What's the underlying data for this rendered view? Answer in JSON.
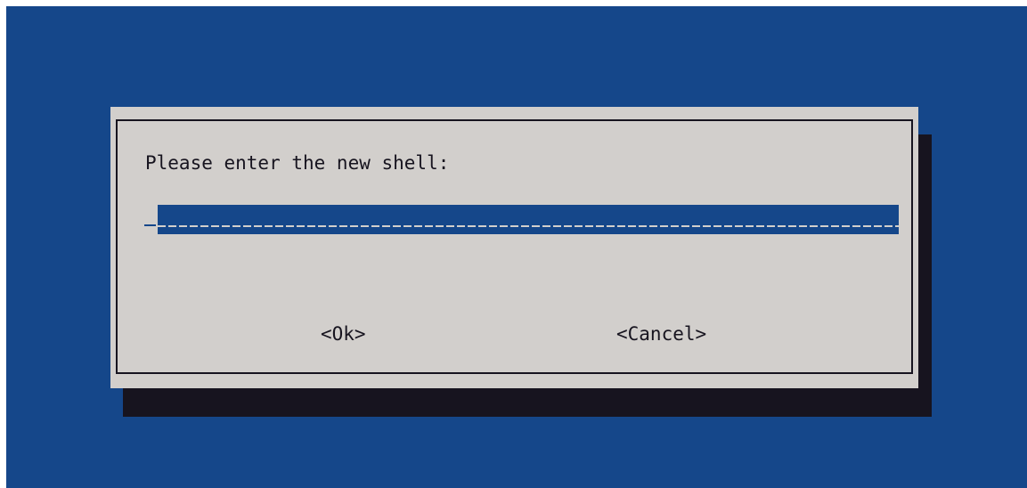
{
  "dialog": {
    "prompt": "Please enter the new shell:",
    "input_value": "",
    "ok_label": "<Ok>",
    "cancel_label": "<Cancel>"
  },
  "colors": {
    "background": "#15478a",
    "dialog": "#d2cfcc",
    "shadow": "#17141f",
    "input": "#15478a",
    "text": "#17141f"
  }
}
